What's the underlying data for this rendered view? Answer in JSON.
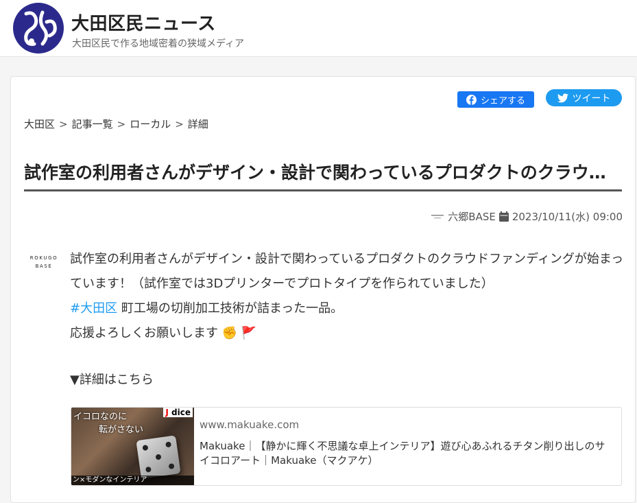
{
  "site": {
    "title": "大田区民ニュース",
    "subtitle": "大田区民で作る地域密着の狭域メディア"
  },
  "share": {
    "facebook_label": "シェアする",
    "twitter_label": "ツイート"
  },
  "breadcrumb": {
    "items": [
      "大田区",
      "記事一覧",
      "ローカル",
      "詳細"
    ],
    "separator": ">"
  },
  "article": {
    "title": "試作室の利用者さんがデザイン・設計で関わっているプロダクトのクラウドファンディングが始まっています！",
    "author": "六郷BASE",
    "date": "2023/10/11(水) 09:00",
    "avatar_line1": "ROKUGO",
    "avatar_line2": "BASE",
    "paragraph1": "試作室の利用者さんがデザイン・設計で関わっているプロダクトのクラウドファンディングが始まっています！（試作室では3Dプリンターでプロトタイプを作られていました）",
    "hashtag": "#大田区",
    "paragraph2_rest": " 町工場の切削加工技術が詰まった一品。",
    "paragraph3": "応援よろしくお願いします ✊ 🚩",
    "detail_heading": "▼詳細はこちら"
  },
  "link_card": {
    "domain": "www.makuake.com",
    "title": "Makuake｜【静かに輝く不思議な卓上インテリア】遊び心あふれるチタン削り出しのサイコロアート｜Makuake（マクアケ）",
    "thumb_text1": "イコロなのに",
    "thumb_text2": "転がさない",
    "thumb_brand": "dice",
    "thumb_bottom": "ン×モダンなインテリア"
  },
  "colors": {
    "facebook": "#1877f2",
    "twitter": "#1d9bf0",
    "logo": "#2b2a8c"
  },
  "icons": {
    "facebook": "facebook-icon",
    "twitter": "twitter-bird-icon",
    "author": "author-logo-icon",
    "calendar": "calendar-icon"
  }
}
